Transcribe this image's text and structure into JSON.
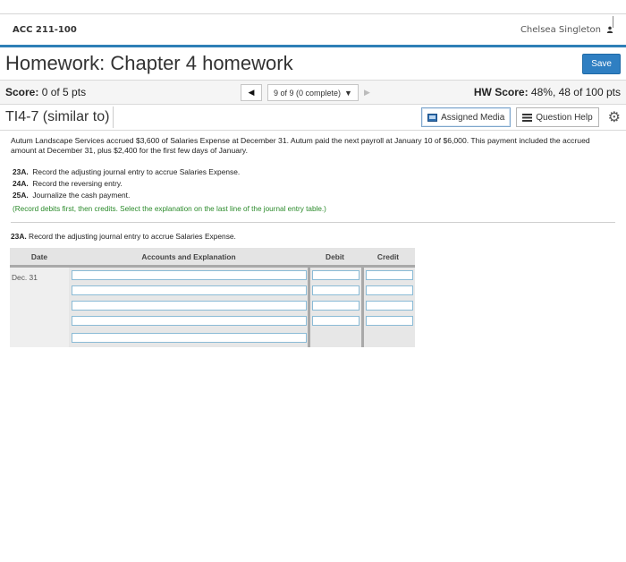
{
  "course": {
    "title": "ACC 211-100",
    "user_name": "Chelsea Singleton"
  },
  "homework": {
    "title": "Homework: Chapter 4 homework",
    "save_label": "Save"
  },
  "score": {
    "label": "Score:",
    "value": "0 of 5 pts",
    "nav_select": "9 of 9 (0 complete)",
    "hw_label": "HW Score:",
    "hw_value": "48%, 48 of 100 pts"
  },
  "question": {
    "title": "TI4-7 (similar to)",
    "assigned_media": "Assigned Media",
    "question_help": "Question Help"
  },
  "problem": {
    "text": "Autum Landscape Services accrued $3,600 of Salaries Expense at December 31. Autum paid the next payroll at January 10 of $6,000. This payment included the accrued amount at December 31, plus $2,400 for the first few days of January.",
    "req_23a_code": "23A.",
    "req_23a_text": "Record the adjusting journal entry to accrue Salaries Expense.",
    "req_24a_code": "24A.",
    "req_24a_text": "Record the reversing entry.",
    "req_25a_code": "25A.",
    "req_25a_text": "Journalize the cash payment.",
    "note": "(Record debits first, then credits. Select the explanation on the last line of the journal entry table.)"
  },
  "part": {
    "code": "23A.",
    "text": "Record the adjusting journal entry to accrue Salaries Expense."
  },
  "journal": {
    "headers": {
      "date": "Date",
      "accounts": "Accounts and Explanation",
      "debit": "Debit",
      "credit": "Credit"
    },
    "date_value": "Dec. 31"
  },
  "colors": {
    "accent": "#2e7fb6",
    "save_button": "#2f7fc2",
    "note_green": "#2a8a2a",
    "input_border": "#8bbbd6"
  },
  "icons": [
    "user-icon",
    "triangle-left-icon",
    "triangle-down-icon",
    "triangle-right-icon",
    "media-icon",
    "list-icon",
    "gear-icon"
  ]
}
